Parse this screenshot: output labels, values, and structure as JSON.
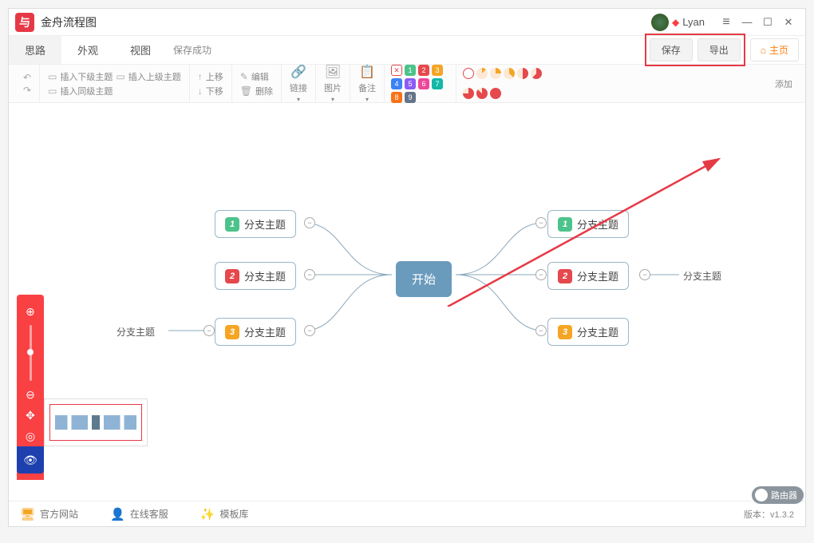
{
  "title": "金舟流程图",
  "user": {
    "name": "Lyan"
  },
  "tabs": [
    "思路",
    "外观",
    "视图"
  ],
  "saveStatus": "保存成功",
  "actions": {
    "save": "保存",
    "export": "导出",
    "home": "主页"
  },
  "toolbar": {
    "insert_sub": "插入下级主题",
    "insert_parent": "插入上级主题",
    "insert_sibling": "插入同级主题",
    "move_up": "上移",
    "move_down": "下移",
    "edit": "编辑",
    "delete": "删除",
    "link": "链接",
    "image": "图片",
    "note": "备注",
    "add": "添加"
  },
  "mindmap": {
    "center": "开始",
    "left": [
      {
        "num": "1",
        "label": "分支主题",
        "color": "g"
      },
      {
        "num": "2",
        "label": "分支主题",
        "color": "r"
      },
      {
        "num": "3",
        "label": "分支主题",
        "color": "y"
      }
    ],
    "right": [
      {
        "num": "1",
        "label": "分支主题",
        "color": "g"
      },
      {
        "num": "2",
        "label": "分支主题",
        "color": "r"
      },
      {
        "num": "3",
        "label": "分支主题",
        "color": "y"
      }
    ],
    "extra_left": "分支主题",
    "extra_right": "分支主题"
  },
  "footer": {
    "website": "官方网站",
    "support": "在线客服",
    "templates": "模板库",
    "version_label": "版本：",
    "version": "v1.3.2"
  },
  "badge": "路由器",
  "number_markers": [
    {
      "n": "1",
      "c": "#4cc38a"
    },
    {
      "n": "2",
      "c": "#e5484d"
    },
    {
      "n": "3",
      "c": "#f5a524"
    },
    {
      "n": "4",
      "c": "#3b82f6"
    },
    {
      "n": "5",
      "c": "#8b5cf6"
    },
    {
      "n": "6",
      "c": "#ec4899"
    },
    {
      "n": "7",
      "c": "#14b8a6"
    },
    {
      "n": "8",
      "c": "#f97316"
    },
    {
      "n": "9",
      "c": "#64748b"
    }
  ],
  "progress_markers": [
    "#f5a524",
    "#f5a524",
    "#f5a524",
    "#e5484d",
    "#e5484d",
    "#e5484d",
    "#e5484d",
    "#e5484d"
  ]
}
